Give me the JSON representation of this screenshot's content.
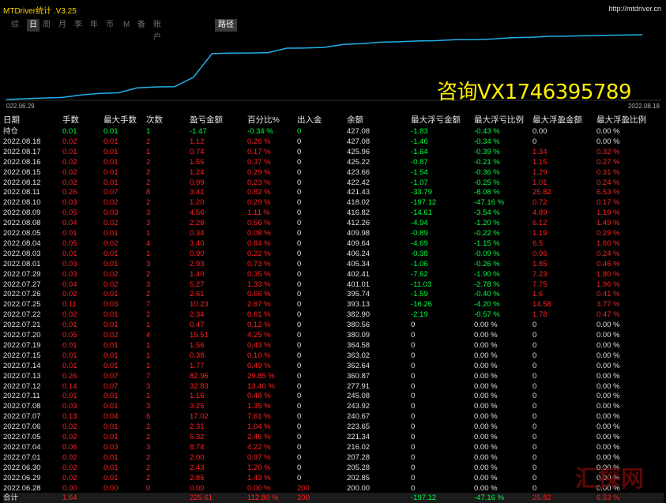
{
  "app": {
    "title": "MTDriver统计 .V3.25",
    "url": "http://mtdriver.cn"
  },
  "tabs": [
    {
      "label": "综",
      "active": false
    },
    {
      "label": "日",
      "active": true
    },
    {
      "label": "周",
      "active": false
    },
    {
      "label": "月",
      "active": false
    },
    {
      "label": "季",
      "active": false
    },
    {
      "label": "年",
      "active": false
    },
    {
      "label": "币",
      "active": false
    },
    {
      "label": "M",
      "active": false
    },
    {
      "label": "备",
      "active": false
    },
    {
      "label": "账户",
      "active": false
    }
  ],
  "path_button": "路径",
  "chart": {
    "start_date": "022.06.29",
    "end_date": "2022.08.18",
    "line_color": "#22b0e8",
    "type": "line"
  },
  "watermark": "咨询VX1746395789",
  "logo": "汇探网",
  "table": {
    "headers": [
      "日期",
      "手数",
      "最大手数",
      "次数",
      "盈亏金额",
      "百分比%",
      "出入金",
      "余额",
      "最大浮亏金额",
      "最大浮亏比例",
      "最大浮盈金额",
      "最大浮盈比例"
    ],
    "rows": [
      [
        "持仓",
        "0.01",
        "0.01",
        "1",
        "-1.47",
        "-0.34 %",
        "0",
        "427.08",
        "-1.83",
        "-0.43 %",
        "0.00",
        "0.00 %"
      ],
      [
        "2022.08.18",
        "0.02",
        "0.01",
        "2",
        "1.12",
        "0.26 %",
        "0",
        "427.08",
        "-1.46",
        "-0.34 %",
        "0",
        "0.00 %"
      ],
      [
        "2022.08.17",
        "0.01",
        "0.01",
        "1",
        "0.74",
        "0.17 %",
        "0",
        "425.96",
        "-1.64",
        "-0.39 %",
        "1.34",
        "0.32 %"
      ],
      [
        "2022.08.16",
        "0.02",
        "0.01",
        "2",
        "1.56",
        "0.37 %",
        "0",
        "425.22",
        "-0.87",
        "-0.21 %",
        "1.15",
        "0.27 %"
      ],
      [
        "2022.08.15",
        "0.02",
        "0.01",
        "2",
        "1.24",
        "0.29 %",
        "0",
        "423.66",
        "-1.54",
        "-0.36 %",
        "1.29",
        "0.31 %"
      ],
      [
        "2022.08.12",
        "0.02",
        "0.01",
        "2",
        "0.99",
        "0.23 %",
        "0",
        "422.42",
        "-1.07",
        "-0.25 %",
        "1.01",
        "0.24 %"
      ],
      [
        "2022.08.11",
        "0.26",
        "0.07",
        "8",
        "3.41",
        "0.82 %",
        "0",
        "421.43",
        "-33.79",
        "-8.08 %",
        "25.82",
        "6.53 %"
      ],
      [
        "2022.08.10",
        "0.03",
        "0.02",
        "2",
        "1.20",
        "0.29 %",
        "0",
        "418.02",
        "-197.12",
        "-47.16 %",
        "0.72",
        "0.17 %"
      ],
      [
        "2022.08.09",
        "0.05",
        "0.03",
        "3",
        "4.56",
        "1.11 %",
        "0",
        "416.82",
        "-14.61",
        "-3.54 %",
        "4.89",
        "1.19 %"
      ],
      [
        "2022.08.08",
        "0.04",
        "0.02",
        "3",
        "2.28",
        "0.56 %",
        "0",
        "412.26",
        "-4.94",
        "-1.20 %",
        "6.12",
        "1.49 %"
      ],
      [
        "2022.08.05",
        "0.01",
        "0.01",
        "1",
        "0.34",
        "0.08 %",
        "0",
        "409.98",
        "-0.89",
        "-0.22 %",
        "1.19",
        "0.29 %"
      ],
      [
        "2022.08.04",
        "0.05",
        "0.02",
        "4",
        "3.40",
        "0.84 %",
        "0",
        "409.64",
        "-4.69",
        "-1.15 %",
        "6.5",
        "1.60 %"
      ],
      [
        "2022.08.03",
        "0.01",
        "0.01",
        "1",
        "0.90",
        "0.22 %",
        "0",
        "406.24",
        "-0.38",
        "-0.09 %",
        "0.96",
        "0.24 %"
      ],
      [
        "2022.08.01",
        "0.03",
        "0.01",
        "3",
        "2.93",
        "0.73 %",
        "0",
        "405.34",
        "-1.06",
        "-0.26 %",
        "1.85",
        "0.46 %"
      ],
      [
        "2022.07.29",
        "0.03",
        "0.02",
        "2",
        "1.40",
        "0.35 %",
        "0",
        "402.41",
        "-7.62",
        "-1.90 %",
        "7.23",
        "1.80 %"
      ],
      [
        "2022.07.27",
        "0.04",
        "0.02",
        "3",
        "5.27",
        "1.33 %",
        "0",
        "401.01",
        "-11.03",
        "-2.78 %",
        "7.75",
        "1.96 %"
      ],
      [
        "2022.07.26",
        "0.02",
        "0.01",
        "2",
        "2.61",
        "0.66 %",
        "0",
        "395.74",
        "-1.59",
        "-0.40 %",
        "1.6",
        "0.41 %"
      ],
      [
        "2022.07.25",
        "0.11",
        "0.03",
        "7",
        "10.23",
        "2.67 %",
        "0",
        "393.13",
        "-16.26",
        "-4.20 %",
        "14.58",
        "3.77 %"
      ],
      [
        "2022.07.22",
        "0.02",
        "0.01",
        "2",
        "2.34",
        "0.61 %",
        "0",
        "382.90",
        "-2.19",
        "-0.57 %",
        "1.78",
        "0.47 %"
      ],
      [
        "2022.07.21",
        "0.01",
        "0.01",
        "1",
        "0.47",
        "0.12 %",
        "0",
        "380.56",
        "0",
        "0.00 %",
        "0",
        "0.00 %"
      ],
      [
        "2022.07.20",
        "0.05",
        "0.02",
        "4",
        "15.51",
        "4.25 %",
        "0",
        "380.09",
        "0",
        "0.00 %",
        "0",
        "0.00 %"
      ],
      [
        "2022.07.19",
        "0.01",
        "0.01",
        "1",
        "1.56",
        "0.43 %",
        "0",
        "364.58",
        "0",
        "0.00 %",
        "0",
        "0.00 %"
      ],
      [
        "2022.07.15",
        "0.01",
        "0.01",
        "1",
        "0.38",
        "0.10 %",
        "0",
        "363.02",
        "0",
        "0.00 %",
        "0",
        "0.00 %"
      ],
      [
        "2022.07.14",
        "0.01",
        "0.01",
        "1",
        "1.77",
        "0.49 %",
        "0",
        "362.64",
        "0",
        "0.00 %",
        "0",
        "0.00 %"
      ],
      [
        "2022.07.13",
        "0.26",
        "0.07",
        "7",
        "82.96",
        "29.85 %",
        "0",
        "360.87",
        "0",
        "0.00 %",
        "0",
        "0.00 %"
      ],
      [
        "2022.07.12",
        "0.14",
        "0.07",
        "3",
        "32.83",
        "13.40 %",
        "0",
        "277.91",
        "0",
        "0.00 %",
        "0",
        "0.00 %"
      ],
      [
        "2022.07.11",
        "0.01",
        "0.01",
        "1",
        "1.16",
        "0.48 %",
        "0",
        "245.08",
        "0",
        "0.00 %",
        "0",
        "0.00 %"
      ],
      [
        "2022.07.08",
        "0.03",
        "0.01",
        "3",
        "3.25",
        "1.35 %",
        "0",
        "243.92",
        "0",
        "0.00 %",
        "0",
        "0.00 %"
      ],
      [
        "2022.07.07",
        "0.13",
        "0.04",
        "6",
        "17.02",
        "7.61 %",
        "0",
        "240.67",
        "0",
        "0.00 %",
        "0",
        "0.00 %"
      ],
      [
        "2022.07.06",
        "0.02",
        "0.01",
        "2",
        "2.31",
        "1.04 %",
        "0",
        "223.65",
        "0",
        "0.00 %",
        "0",
        "0.00 %"
      ],
      [
        "2022.07.05",
        "0.02",
        "0.01",
        "2",
        "5.32",
        "2.46 %",
        "0",
        "221.34",
        "0",
        "0.00 %",
        "0",
        "0.00 %"
      ],
      [
        "2022.07.04",
        "0.06",
        "0.03",
        "3",
        "8.74",
        "4.22 %",
        "0",
        "216.02",
        "0",
        "0.00 %",
        "0",
        "0.00 %"
      ],
      [
        "2022.07.01",
        "0.02",
        "0.01",
        "2",
        "2.00",
        "0.97 %",
        "0",
        "207.28",
        "0",
        "0.00 %",
        "0",
        "0.00 %"
      ],
      [
        "2022.06.30",
        "0.02",
        "0.01",
        "2",
        "2.43",
        "1.20 %",
        "0",
        "205.28",
        "0",
        "0.00 %",
        "0",
        "0.00 %"
      ],
      [
        "2022.06.29",
        "0.02",
        "0.01",
        "2",
        "2.85",
        "1.43 %",
        "0",
        "202.85",
        "0",
        "0.00 %",
        "0",
        "0.00 %"
      ],
      [
        "2022.06.28",
        "0.00",
        "0.00",
        "0",
        "0.00",
        "0.00 %",
        "200",
        "200.00",
        "0",
        "0.00 %",
        "0",
        "0.00 %"
      ]
    ],
    "total": [
      "合计",
      "1.64",
      "",
      "",
      "225.61",
      "112.80 %",
      "200",
      "",
      "-197.12",
      "-47.16 %",
      "25.82",
      "6.53 %"
    ]
  },
  "colors": {
    "title": "#ffd400",
    "profit": "#ff2020",
    "positive_total": "#00ff40",
    "loss": "#00ff40",
    "text": "#e0e0e0",
    "chart_line": "#22b0e8",
    "watermark": "#ffee00"
  }
}
